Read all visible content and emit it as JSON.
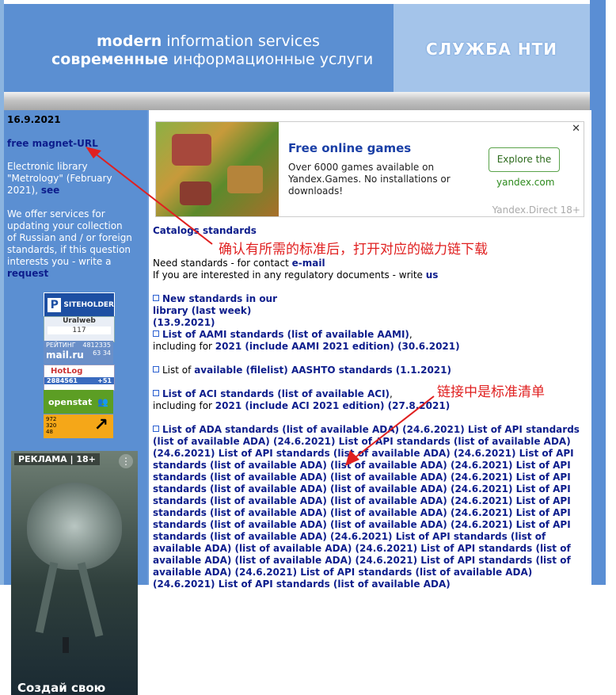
{
  "header": {
    "line1_bold": "modern",
    "line1_rest": " information services",
    "line2_bold": "современные",
    "line2_rest": " информационные услуги",
    "brand": "СЛУЖБА НТИ"
  },
  "sidebar": {
    "date": "16.9.2021",
    "magnet_link": "free magnet-URL",
    "library_text": "Electronic library \"Metrology\" (February 2021),",
    "library_link": "see",
    "services_text": "We offer services for updating your collection of Russian and / or foreign standards, if this question interests you - write a",
    "services_link": "request",
    "counters": {
      "siteholder": "SITEHOLDER",
      "siteholder_letter": "P",
      "uralweb": "Uralweb",
      "uralweb_value": "117",
      "mailru_label": "РЕЙТИНГ",
      "mailru_logo": "mail.ru",
      "mailru_value1": "4812335",
      "mailru_value2": "63",
      "mailru_value3": "34",
      "hotlog": "HotLog",
      "hotlog_value1": "2884561",
      "hotlog_value2": "+51",
      "openstat": "openstat",
      "liveinternet_values": [
        "972",
        "320",
        "48"
      ]
    },
    "ad": {
      "badge": "РЕКЛАМА | 18+",
      "cta": "Создай свою"
    }
  },
  "ad_banner": {
    "title": "Free online games",
    "description": "Over 6000 games available on Yandex.Games. No installations or downloads!",
    "button": "Explore the",
    "domain": "yandex.com",
    "source": "Yandex.Direct  18+",
    "close": "✕"
  },
  "main": {
    "catalogs_heading": "Catalogs standards",
    "need_text": "Need standards - for contact",
    "need_link": "e-mail",
    "interest_text": "If you are interested in any regulatory documents - write",
    "interest_link": "us",
    "new_standards_link": "New standards in our library (last week) (13.9.2021)",
    "aami_link": "List of AAMI standards (list of available AAMI)",
    "aami_including": "including for",
    "aami_2021": "2021 (include AAMI 2021 edition) (30.6.2021)",
    "aashto_prefix": "List of",
    "aashto_link": "available (filelist) AASHTO standards (1.1.2021)",
    "aci_link": "List of ACI standards (list of available ACI)",
    "aci_including": "including for",
    "aci_2021": "2021 (include ACI 2021 edition) (27.8.2021)",
    "api_block": "List of ADA standards (list of available ADA) (24.6.2021) List of API standards (list of available ADA) (24.6.2021) List of API standards (list of available ADA) (24.6.2021) List of API standards (list of available ADA) (24.6.2021) List of API standards (list of available ADA) (list of available ADA) (24.6.2021) List of API standards (list of available ADA) (list of available ADA) (24.6.2021) List of API standards (list of available ADA) (list of available ADA) (24.6.2021) List of API standards (list of available ADA) (list of available ADA) (24.6.2021) List of API standards (list of available ADA) (list of available ADA) (24.6.2021) List of API standards (list of available ADA) (list of available ADA) (24.6.2021) List of API standards (list of available ADA) (24.6.2021) List of API standards (list of available ADA) (list of available ADA) (24.6.2021) List of API standards (list of available ADA) (list of available ADA) (24.6.2021) List of API standards (list of available ADA) (24.6.2021) List of API standards (list of available ADA) (24.6.2021) List of API standards (list of available ADA)"
  },
  "annotations": {
    "top": "确认有所需的标准后，打开对应的磁力链下载",
    "middle": "链接中是标准清单",
    "color": "#e02020"
  }
}
